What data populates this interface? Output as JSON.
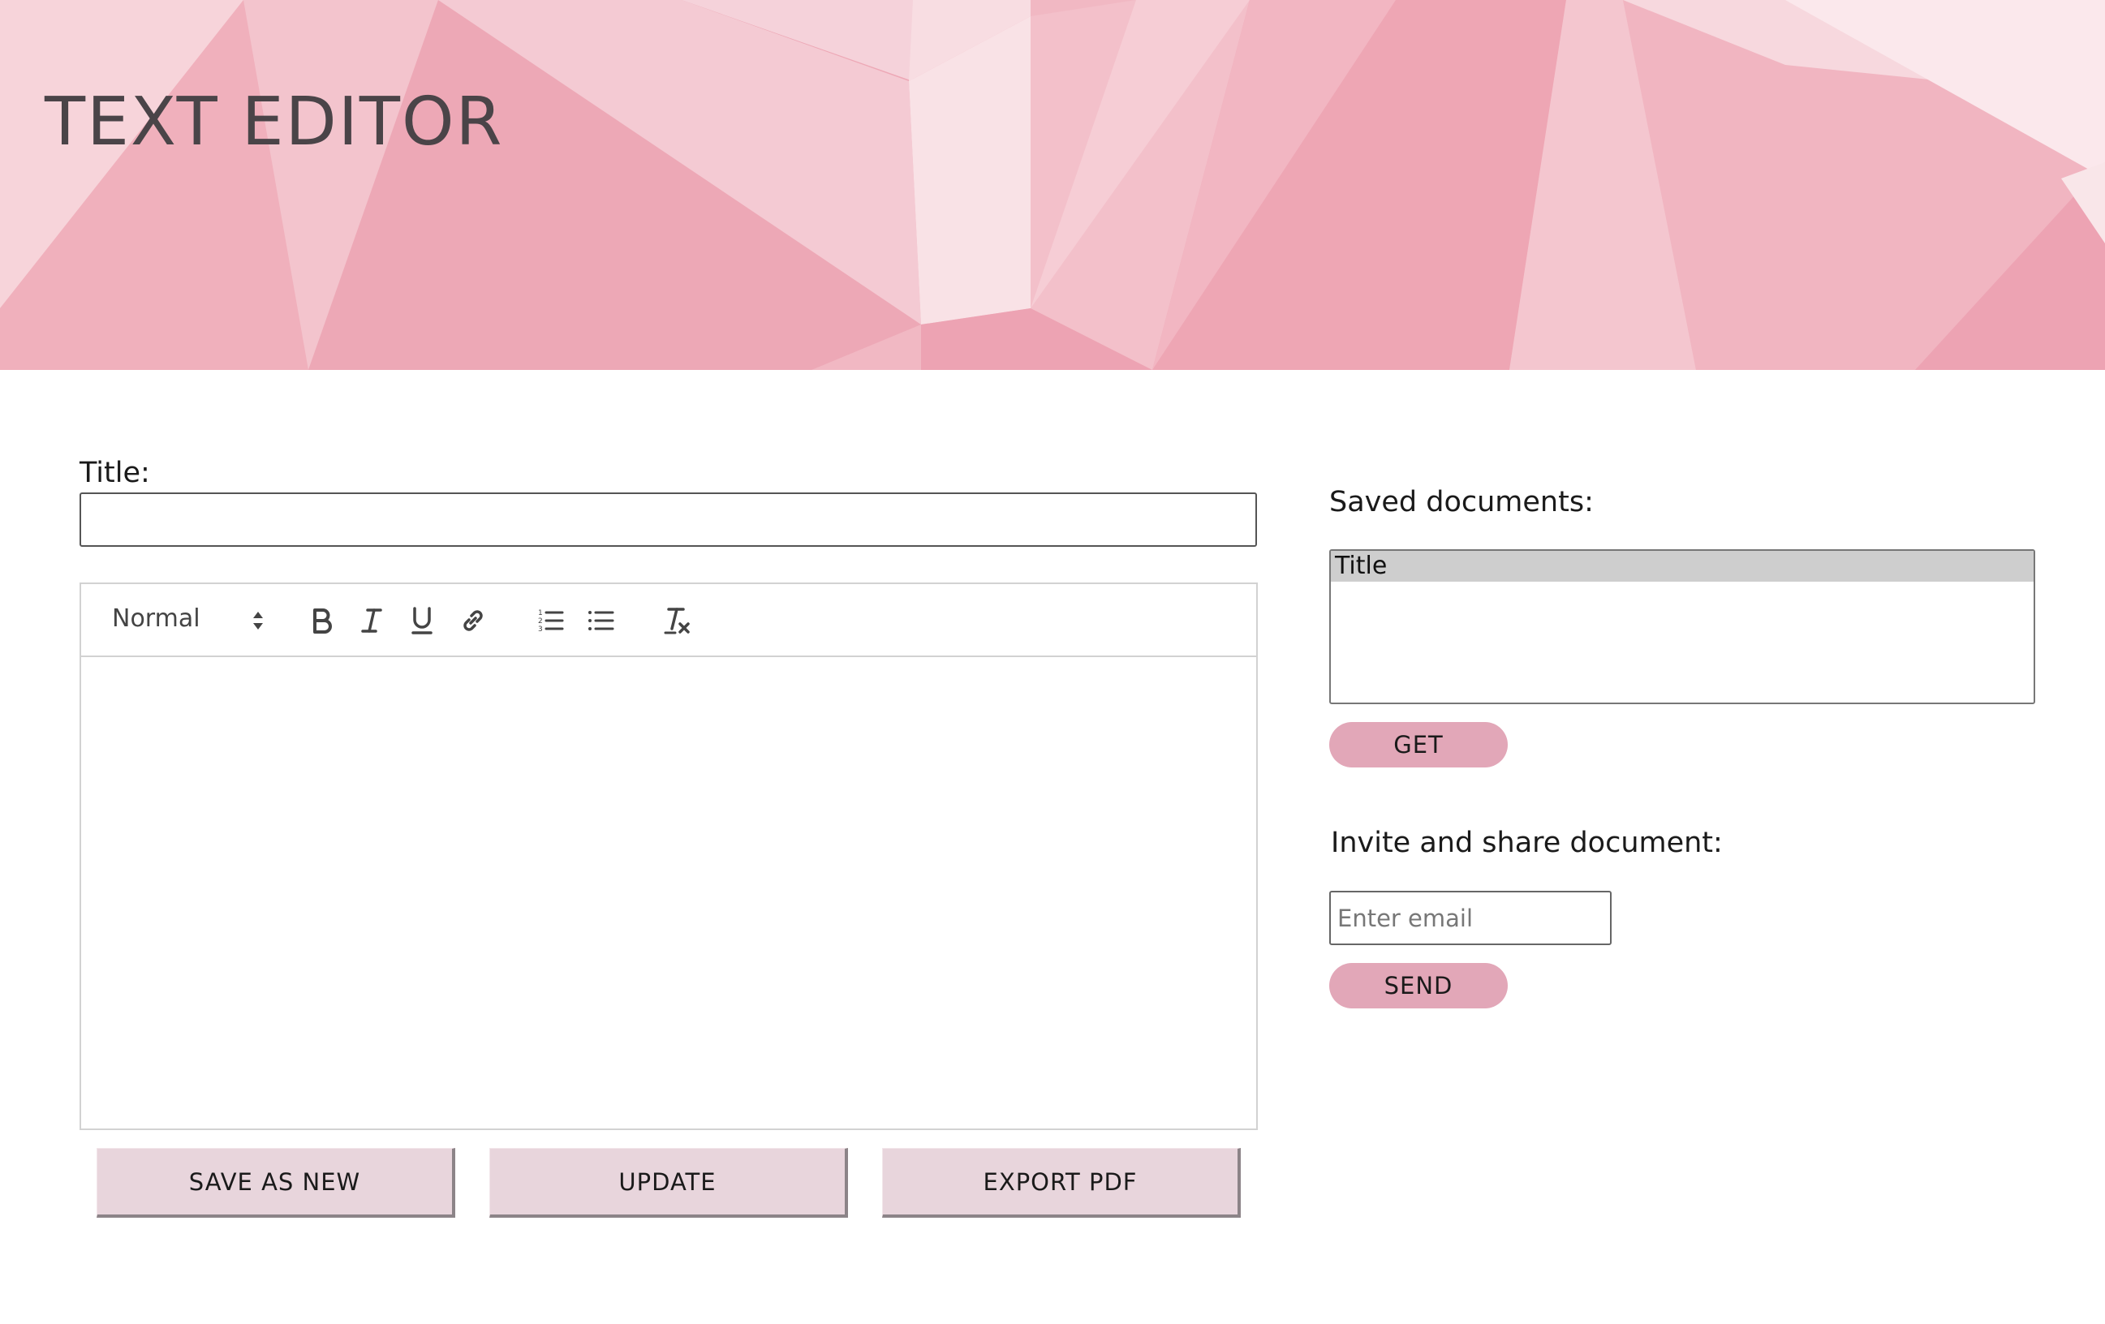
{
  "app": {
    "title": "TEXT EDITOR"
  },
  "editor": {
    "title_label": "Title:",
    "title_value": "",
    "format_select": "Normal",
    "toolbar": {
      "icons": [
        "bold-icon",
        "italic-icon",
        "underline-icon",
        "link-icon",
        "ordered-list-icon",
        "bullet-list-icon",
        "clear-format-icon"
      ]
    },
    "body": ""
  },
  "actions": {
    "save_as_new": "SAVE AS NEW",
    "update": "UPDATE",
    "export_pdf": "EXPORT PDF"
  },
  "saved": {
    "label": "Saved documents:",
    "options": [
      "Title"
    ],
    "get_button": "GET"
  },
  "share": {
    "label": "Invite and share document:",
    "email_placeholder": "Enter email",
    "send_button": "SEND"
  },
  "colors": {
    "banner_pink": "#f1b8c3",
    "pill_button": "#e2a7b8",
    "action_button": "#e8d5dc",
    "title_text": "#4a4448"
  }
}
